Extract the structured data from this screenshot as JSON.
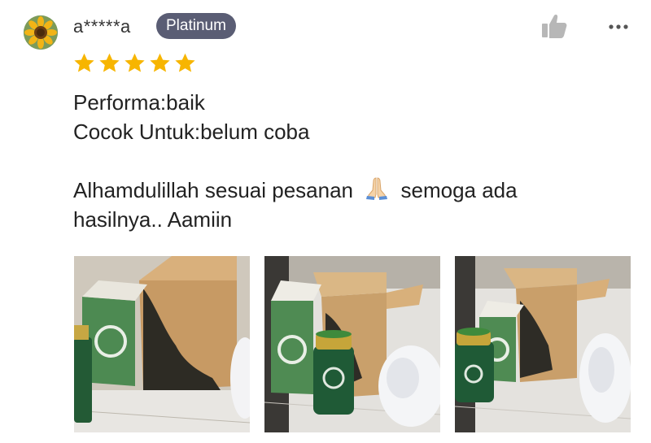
{
  "user": {
    "name": "a*****a",
    "badge": "Platinum",
    "avatar_icon": "sunflower-avatar"
  },
  "rating": {
    "value": 5,
    "max": 5,
    "color": "#f7b500"
  },
  "review": {
    "line1": "Performa:baik",
    "line2": "Cocok Untuk:belum coba",
    "line3_before": "Alhamdulillah sesuai pesanan",
    "line3_after": "semoga ada",
    "line4": "hasilnya.. Aamiin",
    "emoji_icon": "folded-hands-emoji"
  },
  "actions": {
    "like_icon": "thumbs-up-icon",
    "more_icon": "more-options-icon"
  },
  "photos": [
    {
      "name": "review-photo-1"
    },
    {
      "name": "review-photo-2"
    },
    {
      "name": "review-photo-3"
    }
  ]
}
